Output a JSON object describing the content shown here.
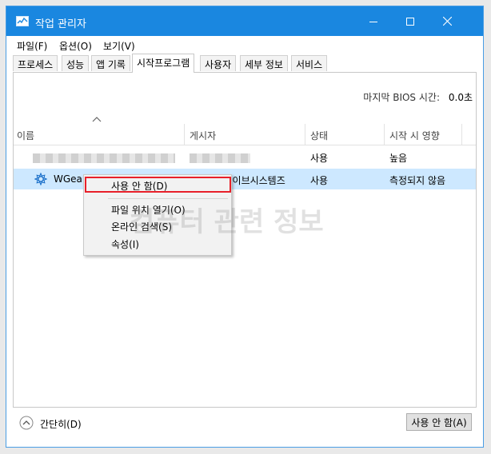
{
  "window": {
    "title": "작업 관리자",
    "icon": "task-manager-icon"
  },
  "menu": [
    "파일(F)",
    "옵션(O)",
    "보기(V)"
  ],
  "tabs": [
    {
      "label": "프로세스"
    },
    {
      "label": "성능"
    },
    {
      "label": "앱 기록"
    },
    {
      "label": "시작프로그램",
      "active": true
    },
    {
      "label": "사용자"
    },
    {
      "label": "세부 정보"
    },
    {
      "label": "서비스"
    }
  ],
  "bios": {
    "label": "마지막 BIOS 시간:",
    "value": "0.0초"
  },
  "columns": [
    "이름",
    "게시자",
    "상태",
    "시작 시 영향"
  ],
  "rows": [
    {
      "name": "",
      "publisher": "",
      "status": "사용",
      "impact": "높음",
      "blurred": true
    },
    {
      "name": "WGear",
      "publisher": "(주)인스웨이브시스템즈",
      "status": "사용",
      "impact": "측정되지 않음",
      "selected": true,
      "icon": "wgear-icon"
    }
  ],
  "context_menu": {
    "items": [
      "사용 안 함(D)",
      "파일 위치 열기(O)",
      "온라인 검색(S)",
      "속성(I)"
    ],
    "highlighted": "사용 안 함(D)"
  },
  "watermark": "컴퓨터 관련 정보",
  "footer": {
    "toggle_label": "간단히(D)",
    "action_button": "사용 안 함(A)"
  },
  "colors": {
    "titlebar": "#1a87e0",
    "selection": "#cde8ff",
    "highlight_border": "#e8202a"
  }
}
